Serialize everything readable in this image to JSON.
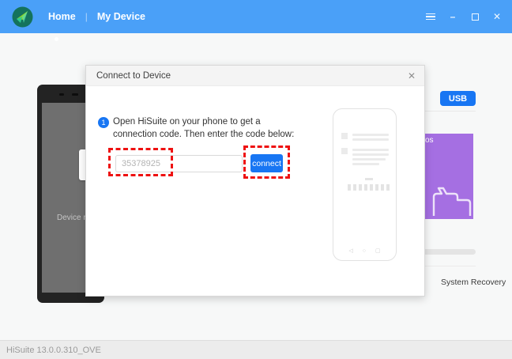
{
  "header": {
    "nav": [
      {
        "label": "Home",
        "active": true
      },
      {
        "label": "My Device",
        "active": false
      }
    ],
    "nav_separator": "|"
  },
  "window_icons": {
    "close": "✕",
    "minimize": "–"
  },
  "dialog": {
    "title": "Connect to Device",
    "close_glyph": "✕",
    "step_number": "1",
    "instruction": "Open HiSuite on your phone to get a connection code. Then enter the code below:",
    "code_input_value": "35378925",
    "connect_label": "connect",
    "phone_nav_icons": {
      "back": "◁",
      "home": "○",
      "recents": "▢"
    }
  },
  "home_page": {
    "usb_button_label": "USB",
    "purple_tile_label_fragment": "os",
    "system_recovery_label": "System Recovery",
    "left_phone_status_fragment": "Device no"
  },
  "status_bar": {
    "version": "HiSuite 13.0.0.310_OVE"
  },
  "colors": {
    "header_blue": "#4AA0F8",
    "accent_blue": "#1876F3",
    "tile_purple": "#A56FE2",
    "annotation_red": "#EE1111"
  }
}
